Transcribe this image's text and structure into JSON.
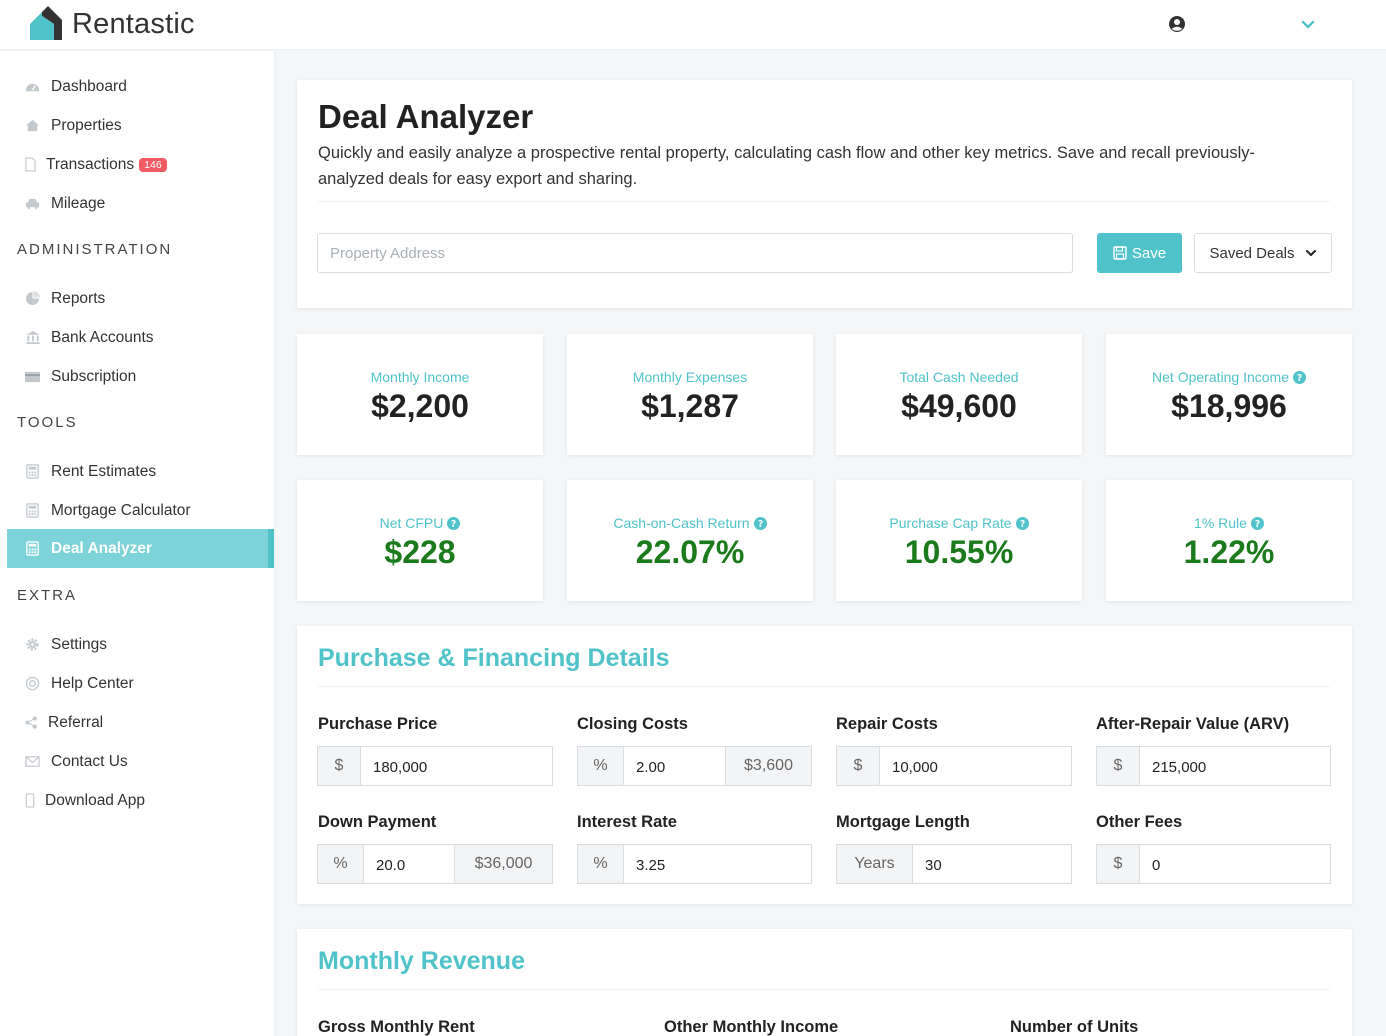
{
  "app": {
    "name": "Rentastic"
  },
  "sidebar": {
    "main": [
      {
        "label": "Dashboard",
        "icon": "dashboard-icon"
      },
      {
        "label": "Properties",
        "icon": "home-icon"
      },
      {
        "label": "Transactions",
        "icon": "file-icon",
        "badge": "146"
      },
      {
        "label": "Mileage",
        "icon": "car-icon"
      }
    ],
    "administration_title": "ADMINISTRATION",
    "administration": [
      {
        "label": "Reports",
        "icon": "pie-chart-icon"
      },
      {
        "label": "Bank Accounts",
        "icon": "bank-icon"
      },
      {
        "label": "Subscription",
        "icon": "card-icon"
      }
    ],
    "tools_title": "TOOLS",
    "tools": [
      {
        "label": "Rent Estimates",
        "icon": "calculator-icon"
      },
      {
        "label": "Mortgage Calculator",
        "icon": "calculator-icon"
      },
      {
        "label": "Deal Analyzer",
        "icon": "calculator-icon",
        "active": true
      }
    ],
    "extra_title": "EXTRA",
    "extra": [
      {
        "label": "Settings",
        "icon": "gear-icon"
      },
      {
        "label": "Help Center",
        "icon": "help-icon"
      },
      {
        "label": "Referral",
        "icon": "share-icon"
      },
      {
        "label": "Contact Us",
        "icon": "envelope-icon"
      },
      {
        "label": "Download App",
        "icon": "mobile-icon"
      }
    ]
  },
  "header": {
    "title": "Deal Analyzer",
    "description": "Quickly and easily analyze a prospective rental property, calculating cash flow and other key metrics. Save and recall previously-analyzed deals for easy export and sharing.",
    "address_placeholder": "Property Address",
    "save_label": "Save",
    "saved_deals_label": "Saved Deals"
  },
  "metrics": [
    {
      "label": "Monthly Income",
      "value": "$2,200",
      "info": false,
      "green": false
    },
    {
      "label": "Monthly Expenses",
      "value": "$1,287",
      "info": false,
      "green": false
    },
    {
      "label": "Total Cash Needed",
      "value": "$49,600",
      "info": false,
      "green": false
    },
    {
      "label": "Net Operating Income",
      "value": "$18,996",
      "info": true,
      "green": false
    },
    {
      "label": "Net CFPU",
      "value": "$228",
      "info": true,
      "green": true
    },
    {
      "label": "Cash-on-Cash Return",
      "value": "22.07%",
      "info": true,
      "green": true
    },
    {
      "label": "Purchase Cap Rate",
      "value": "10.55%",
      "info": true,
      "green": true
    },
    {
      "label": "1% Rule",
      "value": "1.22%",
      "info": true,
      "green": true
    }
  ],
  "purchase": {
    "title": "Purchase & Financing Details",
    "fields": [
      {
        "label": "Purchase Price",
        "prefix": "$",
        "value": "180,000"
      },
      {
        "label": "Closing Costs",
        "prefix": "%",
        "value": "2.00",
        "suffix": "$3,600"
      },
      {
        "label": "Repair Costs",
        "prefix": "$",
        "value": "10,000"
      },
      {
        "label": "After-Repair Value (ARV)",
        "prefix": "$",
        "value": "215,000"
      },
      {
        "label": "Down Payment",
        "prefix": "%",
        "value": "20.0",
        "suffix": "$36,000"
      },
      {
        "label": "Interest Rate",
        "prefix": "%",
        "value": "3.25"
      },
      {
        "label": "Mortgage Length",
        "prefix": "Years",
        "value": "30"
      },
      {
        "label": "Other Fees",
        "prefix": "$",
        "value": "0"
      }
    ]
  },
  "revenue": {
    "title": "Monthly Revenue",
    "labels": [
      "Gross Monthly Rent",
      "Other Monthly Income",
      "Number of Units"
    ]
  },
  "colors": {
    "accent": "#4fc3c9",
    "active_bg": "#7dd3d8",
    "badge": "#ef5a63",
    "positive": "#1b7a1b"
  }
}
